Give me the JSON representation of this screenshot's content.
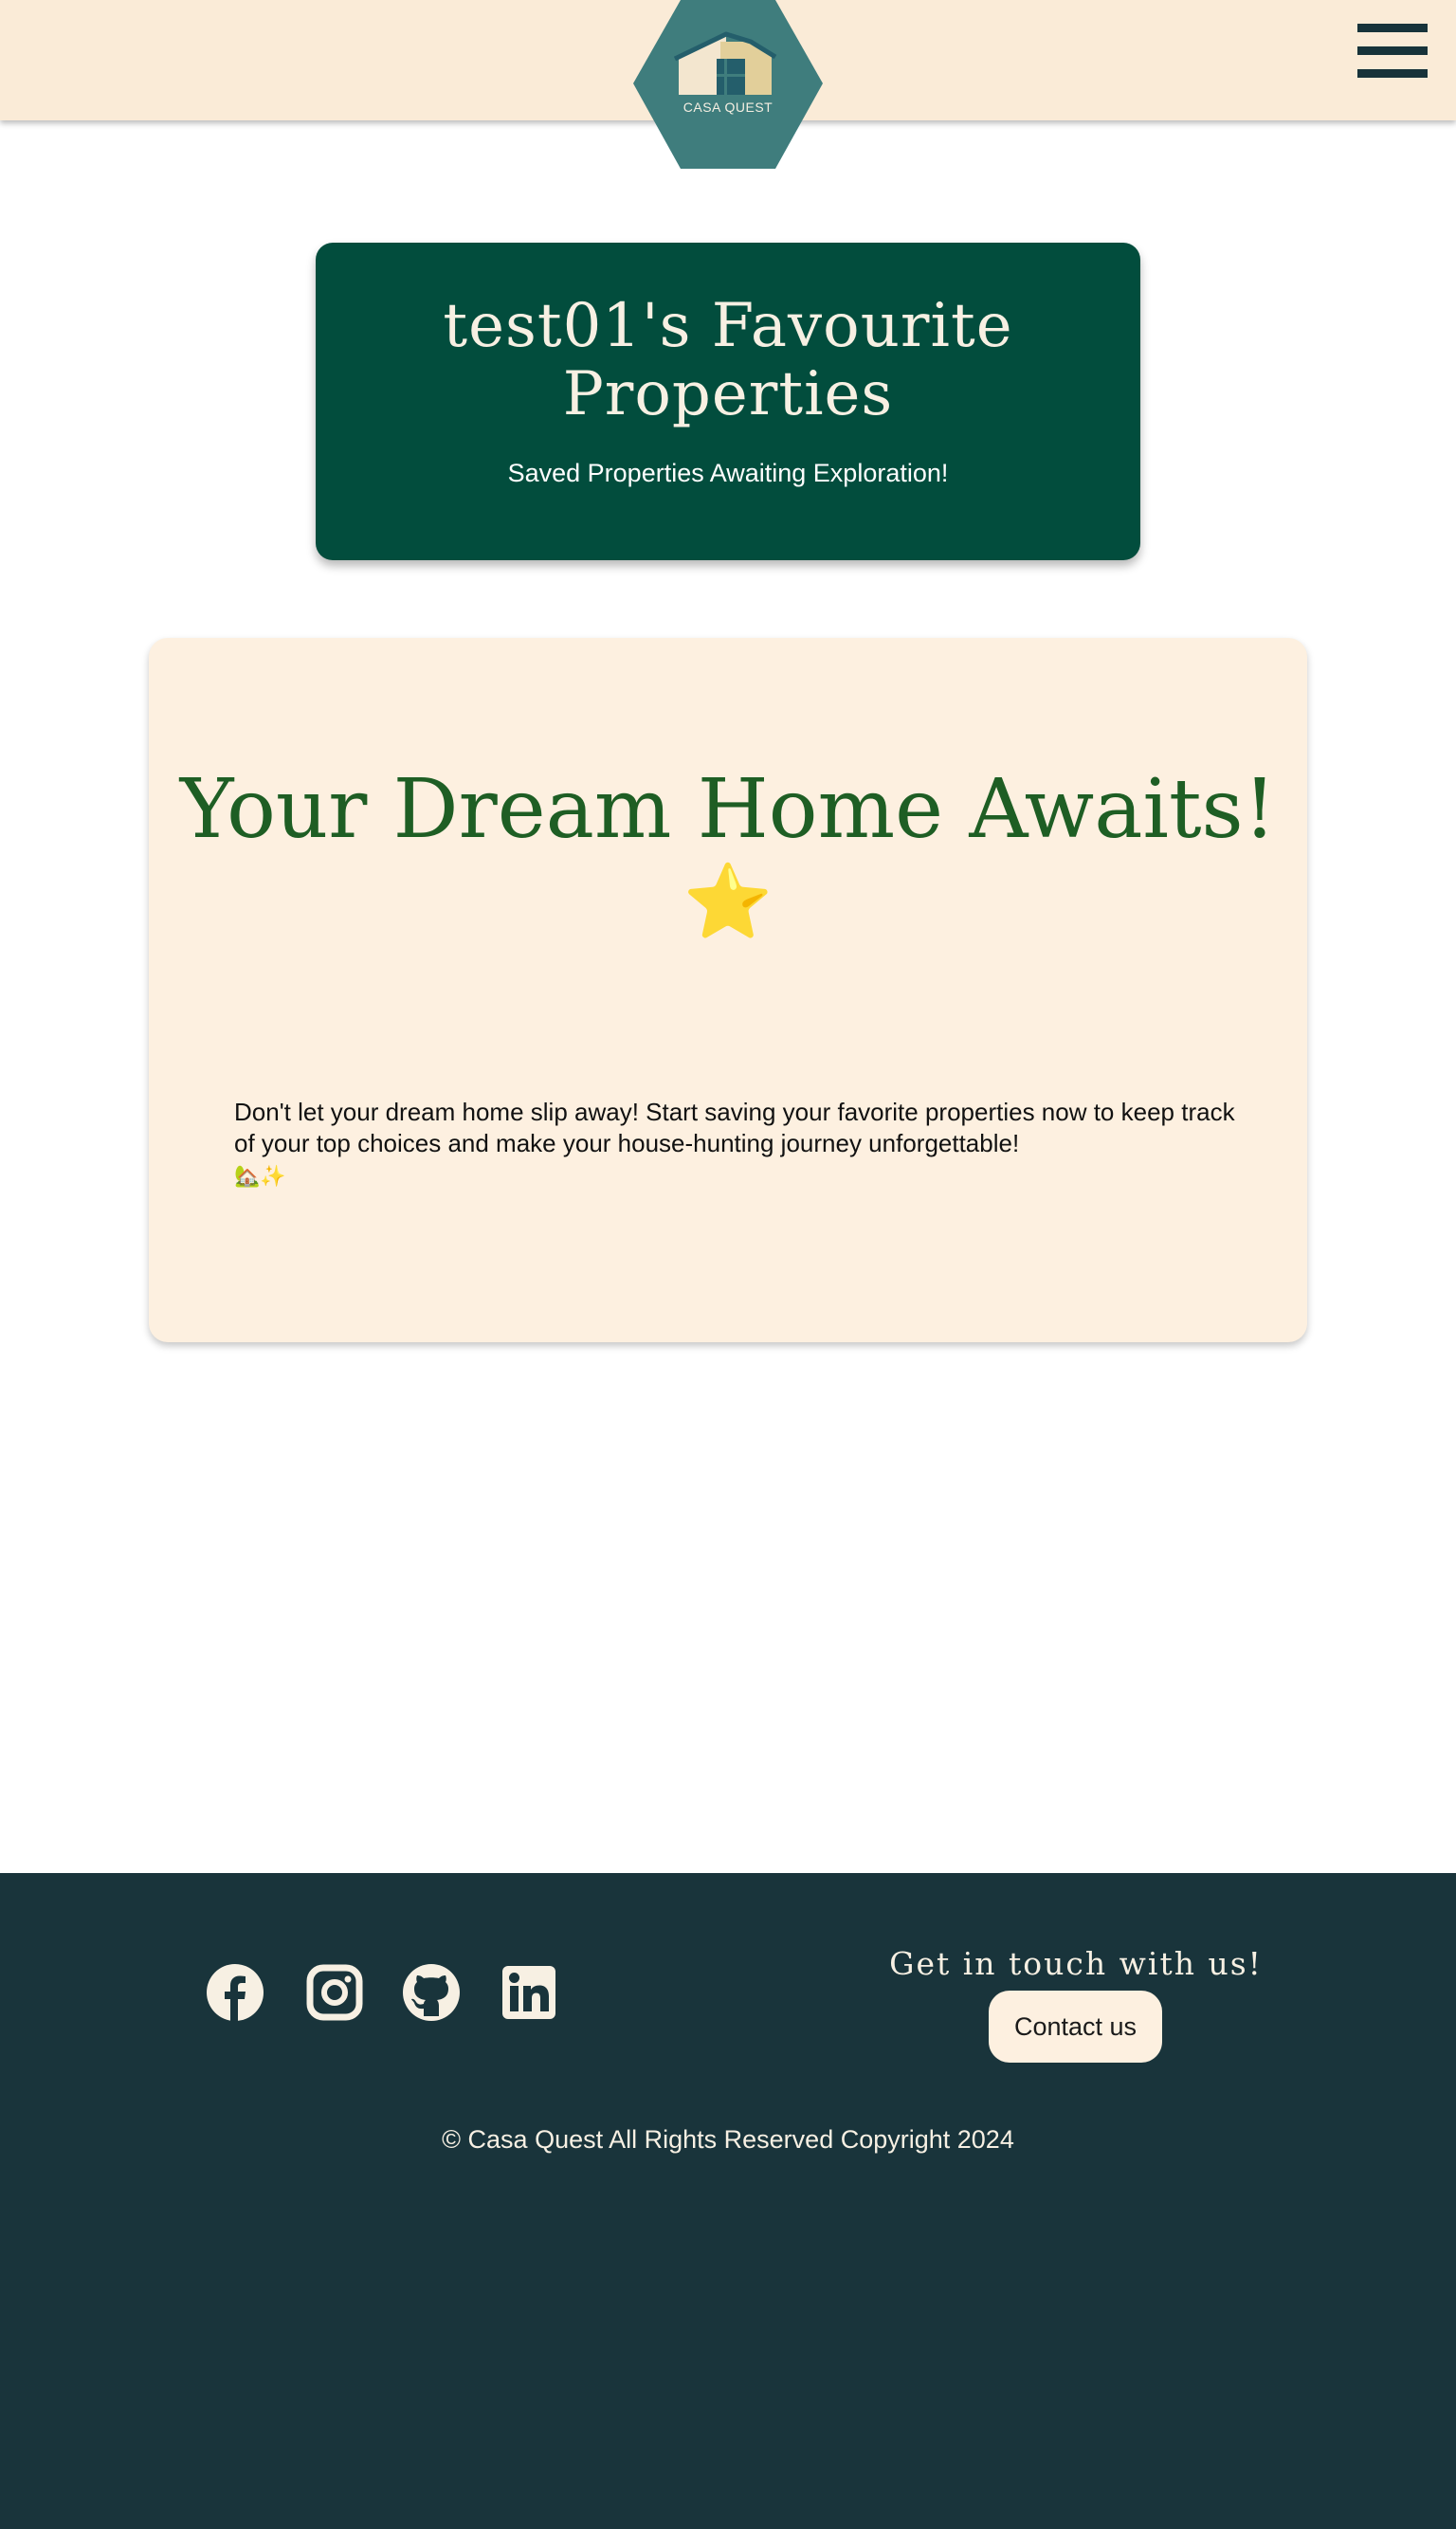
{
  "header": {
    "logo_text": "CASA QUEST",
    "menu_icon": "hamburger-menu-icon"
  },
  "title_card": {
    "title": "test01's Favourite Properties",
    "subtitle": "Saved Properties Awaiting Exploration!"
  },
  "dream_card": {
    "heading": "Your Dream Home Awaits!",
    "heading_emoji": "⭐",
    "body": "Don't let your dream home slip away! Start saving your favorite properties now to keep track of your top choices and make your house-hunting journey unforgettable!",
    "body_emojis": "🏡✨"
  },
  "footer": {
    "social_icons": [
      "facebook-icon",
      "instagram-icon",
      "github-icon",
      "linkedin-icon"
    ],
    "contact_heading": "Get in touch with us!",
    "contact_button": "Contact us",
    "copyright": "© Casa Quest All Rights Reserved Copyright 2024"
  },
  "colors": {
    "header_bg": "#faebd7",
    "title_card_bg": "#024d3d",
    "dream_card_bg": "#fdf0e0",
    "dream_heading": "#1e5e24",
    "footer_bg": "#19343b",
    "logo_hex": "#3f7d7d"
  }
}
